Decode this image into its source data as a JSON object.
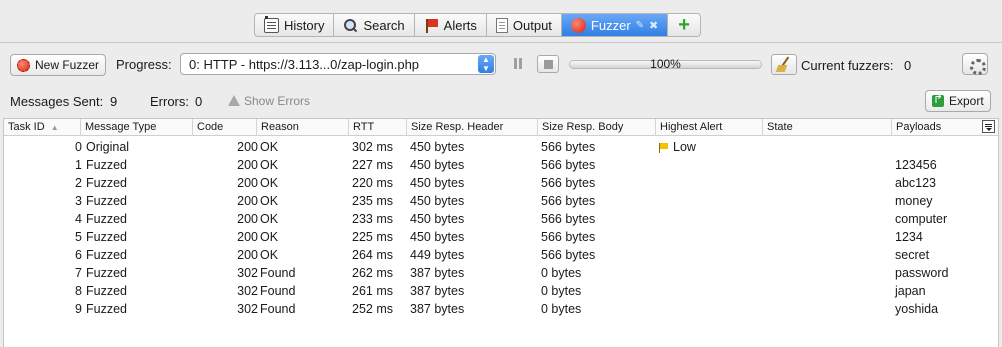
{
  "tabs": [
    {
      "label": "History",
      "icon": "history-icon"
    },
    {
      "label": "Search",
      "icon": "search-icon"
    },
    {
      "label": "Alerts",
      "icon": "alert-flag-icon"
    },
    {
      "label": "Output",
      "icon": "output-document-icon"
    },
    {
      "label": "Fuzzer",
      "icon": "fuzzer-icon",
      "active": true
    }
  ],
  "add_tab_symbol": "+",
  "toolbar": {
    "new_fuzzer_label": "New Fuzzer",
    "progress_label": "Progress:",
    "progress_select_value": "0: HTTP - https://3.113...0/zap-login.php",
    "progress_percent": 100,
    "progress_text": "100%",
    "current_fuzzers_label": "Current fuzzers:",
    "current_fuzzers_value": "0"
  },
  "stats": {
    "messages_sent_label": "Messages Sent:",
    "messages_sent_value": "9",
    "errors_label": "Errors:",
    "errors_value": "0",
    "show_errors_label": "Show Errors",
    "export_label": "Export"
  },
  "table": {
    "headers": [
      "Task ID",
      "Message Type",
      "Code",
      "Reason",
      "RTT",
      "Size Resp. Header",
      "Size Resp. Body",
      "Highest Alert",
      "State",
      "Payloads"
    ],
    "rows": [
      {
        "id": "0",
        "type": "Original",
        "code": "200",
        "reason": "OK",
        "rtt": "302 ms",
        "hdr": "450 bytes",
        "body": "566 bytes",
        "alert": "Low",
        "payload": ""
      },
      {
        "id": "1",
        "type": "Fuzzed",
        "code": "200",
        "reason": "OK",
        "rtt": "227 ms",
        "hdr": "450 bytes",
        "body": "566 bytes",
        "alert": "",
        "payload": "123456"
      },
      {
        "id": "2",
        "type": "Fuzzed",
        "code": "200",
        "reason": "OK",
        "rtt": "220 ms",
        "hdr": "450 bytes",
        "body": "566 bytes",
        "alert": "",
        "payload": "abc123"
      },
      {
        "id": "3",
        "type": "Fuzzed",
        "code": "200",
        "reason": "OK",
        "rtt": "235 ms",
        "hdr": "450 bytes",
        "body": "566 bytes",
        "alert": "",
        "payload": "money"
      },
      {
        "id": "4",
        "type": "Fuzzed",
        "code": "200",
        "reason": "OK",
        "rtt": "233 ms",
        "hdr": "450 bytes",
        "body": "566 bytes",
        "alert": "",
        "payload": "computer"
      },
      {
        "id": "5",
        "type": "Fuzzed",
        "code": "200",
        "reason": "OK",
        "rtt": "225 ms",
        "hdr": "450 bytes",
        "body": "566 bytes",
        "alert": "",
        "payload": "1234"
      },
      {
        "id": "6",
        "type": "Fuzzed",
        "code": "200",
        "reason": "OK",
        "rtt": "264 ms",
        "hdr": "449 bytes",
        "body": "566 bytes",
        "alert": "",
        "payload": "secret"
      },
      {
        "id": "7",
        "type": "Fuzzed",
        "code": "302",
        "reason": "Found",
        "rtt": "262 ms",
        "hdr": "387 bytes",
        "body": "0 bytes",
        "alert": "",
        "payload": "password"
      },
      {
        "id": "8",
        "type": "Fuzzed",
        "code": "302",
        "reason": "Found",
        "rtt": "261 ms",
        "hdr": "387 bytes",
        "body": "0 bytes",
        "alert": "",
        "payload": "japan"
      },
      {
        "id": "9",
        "type": "Fuzzed",
        "code": "302",
        "reason": "Found",
        "rtt": "252 ms",
        "hdr": "387 bytes",
        "body": "0 bytes",
        "alert": "",
        "payload": "yoshida"
      }
    ]
  }
}
